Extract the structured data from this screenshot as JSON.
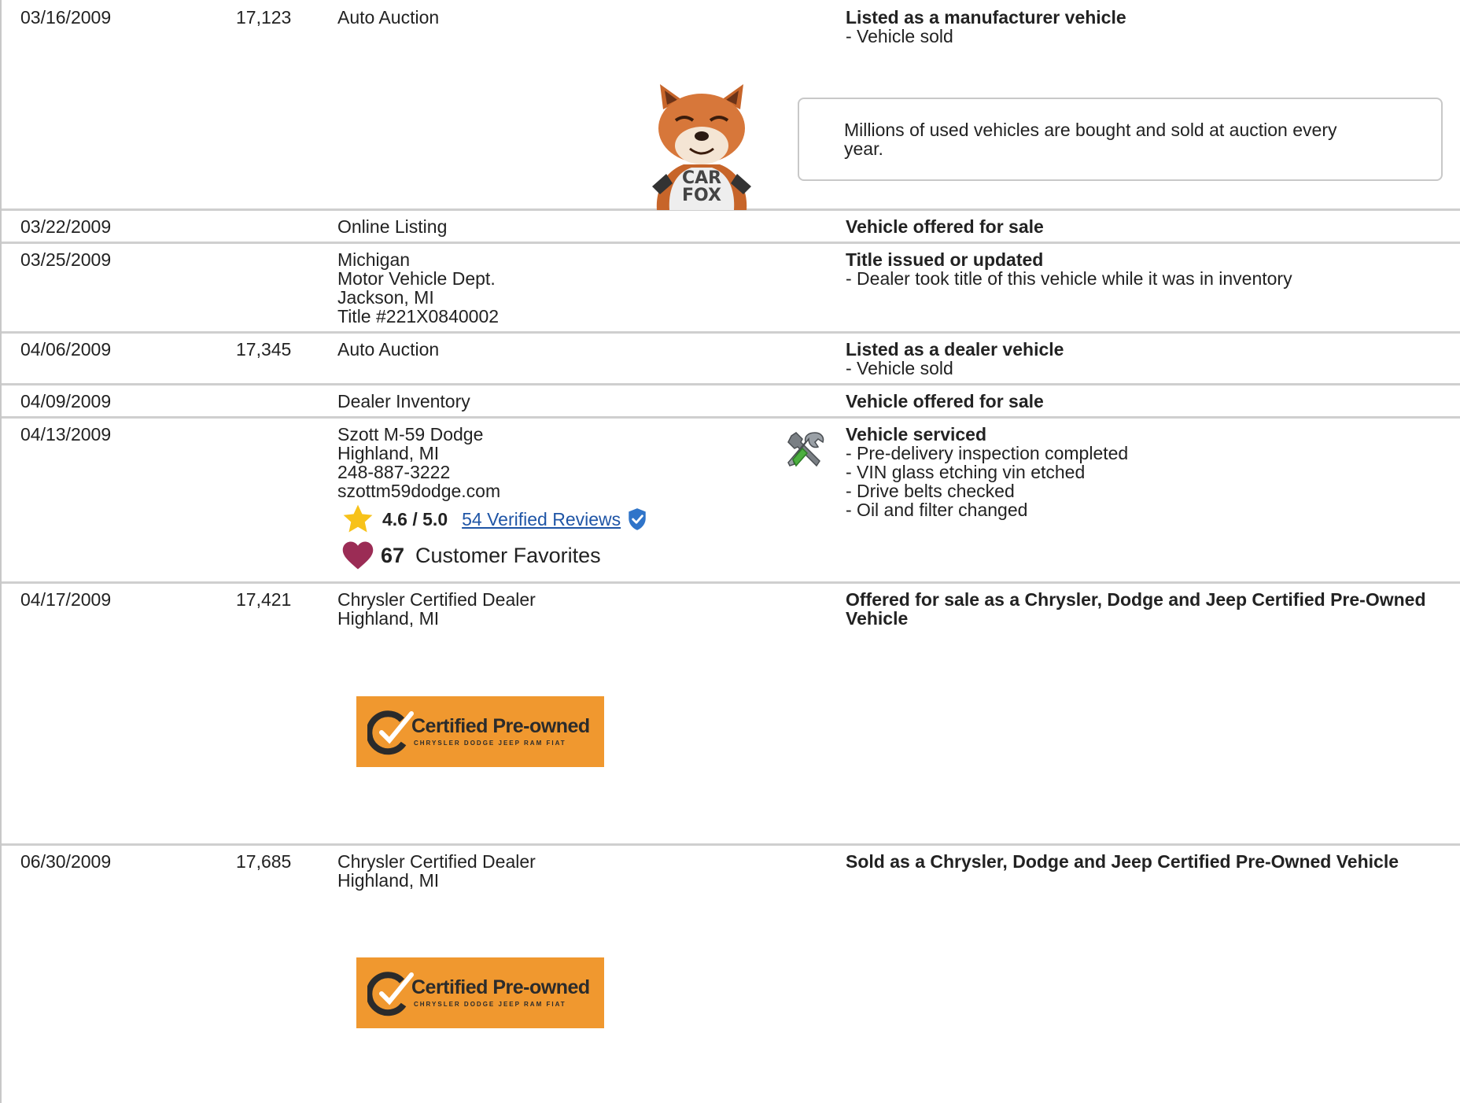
{
  "records": [
    {
      "date": "03/16/2009",
      "odometer": "17,123",
      "source": [
        "Auto Auction"
      ],
      "title": "Listed as a manufacturer vehicle",
      "details": [
        "- Vehicle sold"
      ]
    },
    {
      "date": "03/22/2009",
      "odometer": "",
      "source": [
        "Online Listing"
      ],
      "title": "Vehicle offered for sale",
      "details": []
    },
    {
      "date": "03/25/2009",
      "odometer": "",
      "source": [
        "Michigan",
        "Motor Vehicle Dept.",
        "Jackson, MI",
        "Title #221X0840002"
      ],
      "title": "Title issued or updated",
      "details": [
        "- Dealer took title of this vehicle while it was in inventory"
      ]
    },
    {
      "date": "04/06/2009",
      "odometer": "17,345",
      "source": [
        "Auto Auction"
      ],
      "title": "Listed as a dealer vehicle",
      "details": [
        "- Vehicle sold"
      ]
    },
    {
      "date": "04/09/2009",
      "odometer": "",
      "source": [
        "Dealer Inventory"
      ],
      "title": "Vehicle offered for sale",
      "details": []
    },
    {
      "date": "04/13/2009",
      "odometer": "",
      "source": [
        "Szott M-59 Dodge",
        "Highland, MI",
        "248-887-3222",
        "szottm59dodge.com"
      ],
      "title": "Vehicle serviced",
      "details": [
        "- Pre-delivery inspection completed",
        "- VIN glass etching vin etched",
        "- Drive belts checked",
        "- Oil and filter changed"
      ]
    },
    {
      "date": "04/17/2009",
      "odometer": "17,421",
      "source": [
        "Chrysler Certified Dealer",
        "Highland, MI"
      ],
      "title": "Offered for sale as a Chrysler, Dodge and Jeep Certified Pre-Owned",
      "title2": "Vehicle",
      "details": []
    },
    {
      "date": "06/30/2009",
      "odometer": "17,685",
      "source": [
        "Chrysler Certified Dealer",
        "Highland, MI"
      ],
      "title": "Sold as a Chrysler, Dodge and Jeep Certified Pre-Owned Vehicle",
      "details": []
    }
  ],
  "carfox": {
    "shirt_line1": "CAR",
    "shirt_line2": "FOX",
    "tip_line1": "Millions of used vehicles are bought and sold at auction every",
    "tip_line2": "year."
  },
  "dealer": {
    "rating": "4.6 / 5.0",
    "reviews_link": "54 Verified Reviews",
    "favorites_count": "67",
    "favorites_label": "Customer Favorites"
  },
  "cpo_badge": {
    "title": "Certified Pre-owned",
    "subtitle": "CHRYSLER DODGE JEEP RAM FIAT"
  },
  "colors": {
    "star": "#f7c21a",
    "heart": "#9b2c55",
    "link": "#1f55a6",
    "verified_badge": "#2f74c9",
    "cpo_orange": "#f0982f",
    "row_divider": "#cfcfcf"
  }
}
